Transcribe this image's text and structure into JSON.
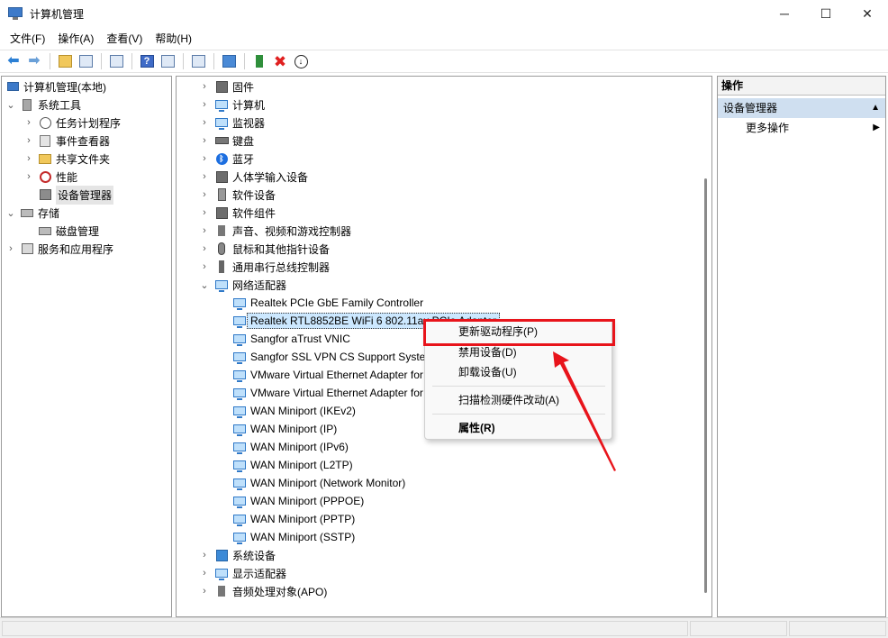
{
  "window": {
    "title": "计算机管理",
    "controls": {
      "minimize": "─",
      "maximize": "☐",
      "close": "✕"
    }
  },
  "menu": [
    "文件(F)",
    "操作(A)",
    "查看(V)",
    "帮助(H)"
  ],
  "toolbar": {
    "icons": [
      "back-arrow-icon",
      "forward-arrow-icon",
      "folder-up-icon",
      "show-tree-icon",
      "export-list-icon",
      "help-icon",
      "properties-icon",
      "refresh-icon",
      "monitor-icon",
      "update-driver-icon",
      "uninstall-icon",
      "disable-icon"
    ],
    "back": "⬅",
    "forward": "➡",
    "help": "?",
    "uninstall": "✖",
    "down": "↓"
  },
  "tree": {
    "root": "计算机管理(本地)",
    "system_tools": "系统工具",
    "task_scheduler": "任务计划程序",
    "event_viewer": "事件查看器",
    "shared_folders": "共享文件夹",
    "performance": "性能",
    "device_manager": "设备管理器",
    "storage": "存储",
    "disk_management": "磁盘管理",
    "services_apps": "服务和应用程序"
  },
  "devices": {
    "categories_top": [
      "固件",
      "计算机",
      "监视器",
      "键盘",
      "蓝牙",
      "人体学输入设备",
      "软件设备",
      "软件组件",
      "声音、视频和游戏控制器",
      "鼠标和其他指针设备",
      "通用串行总线控制器"
    ],
    "network_adapters": "网络适配器",
    "adapters": [
      "Realtek PCIe GbE Family Controller",
      "Realtek RTL8852BE WiFi 6 802.11ax PCIe Adapter",
      "Sangfor aTrust VNIC",
      "Sangfor SSL VPN CS Support System VNIC",
      "VMware Virtual Ethernet Adapter for VMnet1",
      "VMware Virtual Ethernet Adapter for VMnet8",
      "WAN Miniport (IKEv2)",
      "WAN Miniport (IP)",
      "WAN Miniport (IPv6)",
      "WAN Miniport (L2TP)",
      "WAN Miniport (Network Monitor)",
      "WAN Miniport (PPPOE)",
      "WAN Miniport (PPTP)",
      "WAN Miniport (SSTP)"
    ],
    "categories_bottom": [
      "系统设备",
      "显示适配器",
      "音频处理对象(APO)"
    ]
  },
  "actions": {
    "header": "操作",
    "section": "设备管理器",
    "more": "更多操作",
    "collapse_glyph": "▲",
    "more_glyph": "▶"
  },
  "context_menu": {
    "update_driver": "更新驱动程序(P)",
    "disable_device": "禁用设备(D)",
    "uninstall_device": "卸载设备(U)",
    "scan_hardware": "扫描检测硬件改动(A)",
    "properties": "属性(R)"
  },
  "colors": {
    "highlight": "#e8141b",
    "selection": "#cce8ff",
    "action_section": "#cfdff0"
  }
}
